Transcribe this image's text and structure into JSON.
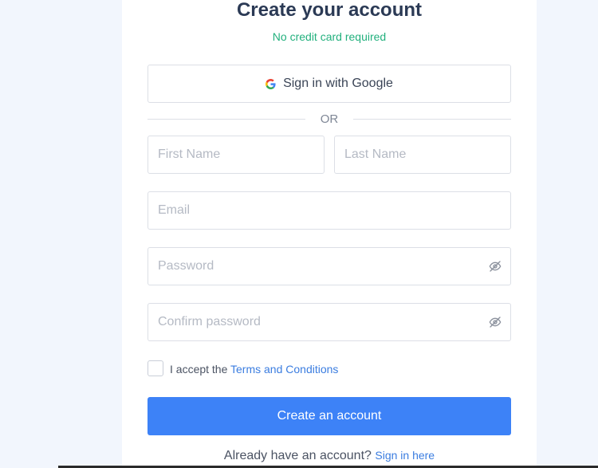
{
  "header": {
    "title": "Create your account",
    "subtitle": "No credit card required"
  },
  "google": {
    "label": "Sign in with Google",
    "icon": "google-icon"
  },
  "divider_text": "OR",
  "fields": {
    "first_name_placeholder": "First Name",
    "last_name_placeholder": "Last Name",
    "email_placeholder": "Email",
    "password_placeholder": "Password",
    "confirm_password_placeholder": "Confirm password",
    "password_toggle_icon": "eye-slash-icon"
  },
  "terms": {
    "prefix": "I accept the ",
    "link": "Terms and Conditions",
    "checked": false
  },
  "submit_label": "Create an account",
  "signin": {
    "prompt": "Already have an account?",
    "link": "Sign in here"
  },
  "colors": {
    "accent": "#3d82f7",
    "subtitle": "#22b07d",
    "title": "#2b3a55",
    "link": "#3b7de0"
  }
}
